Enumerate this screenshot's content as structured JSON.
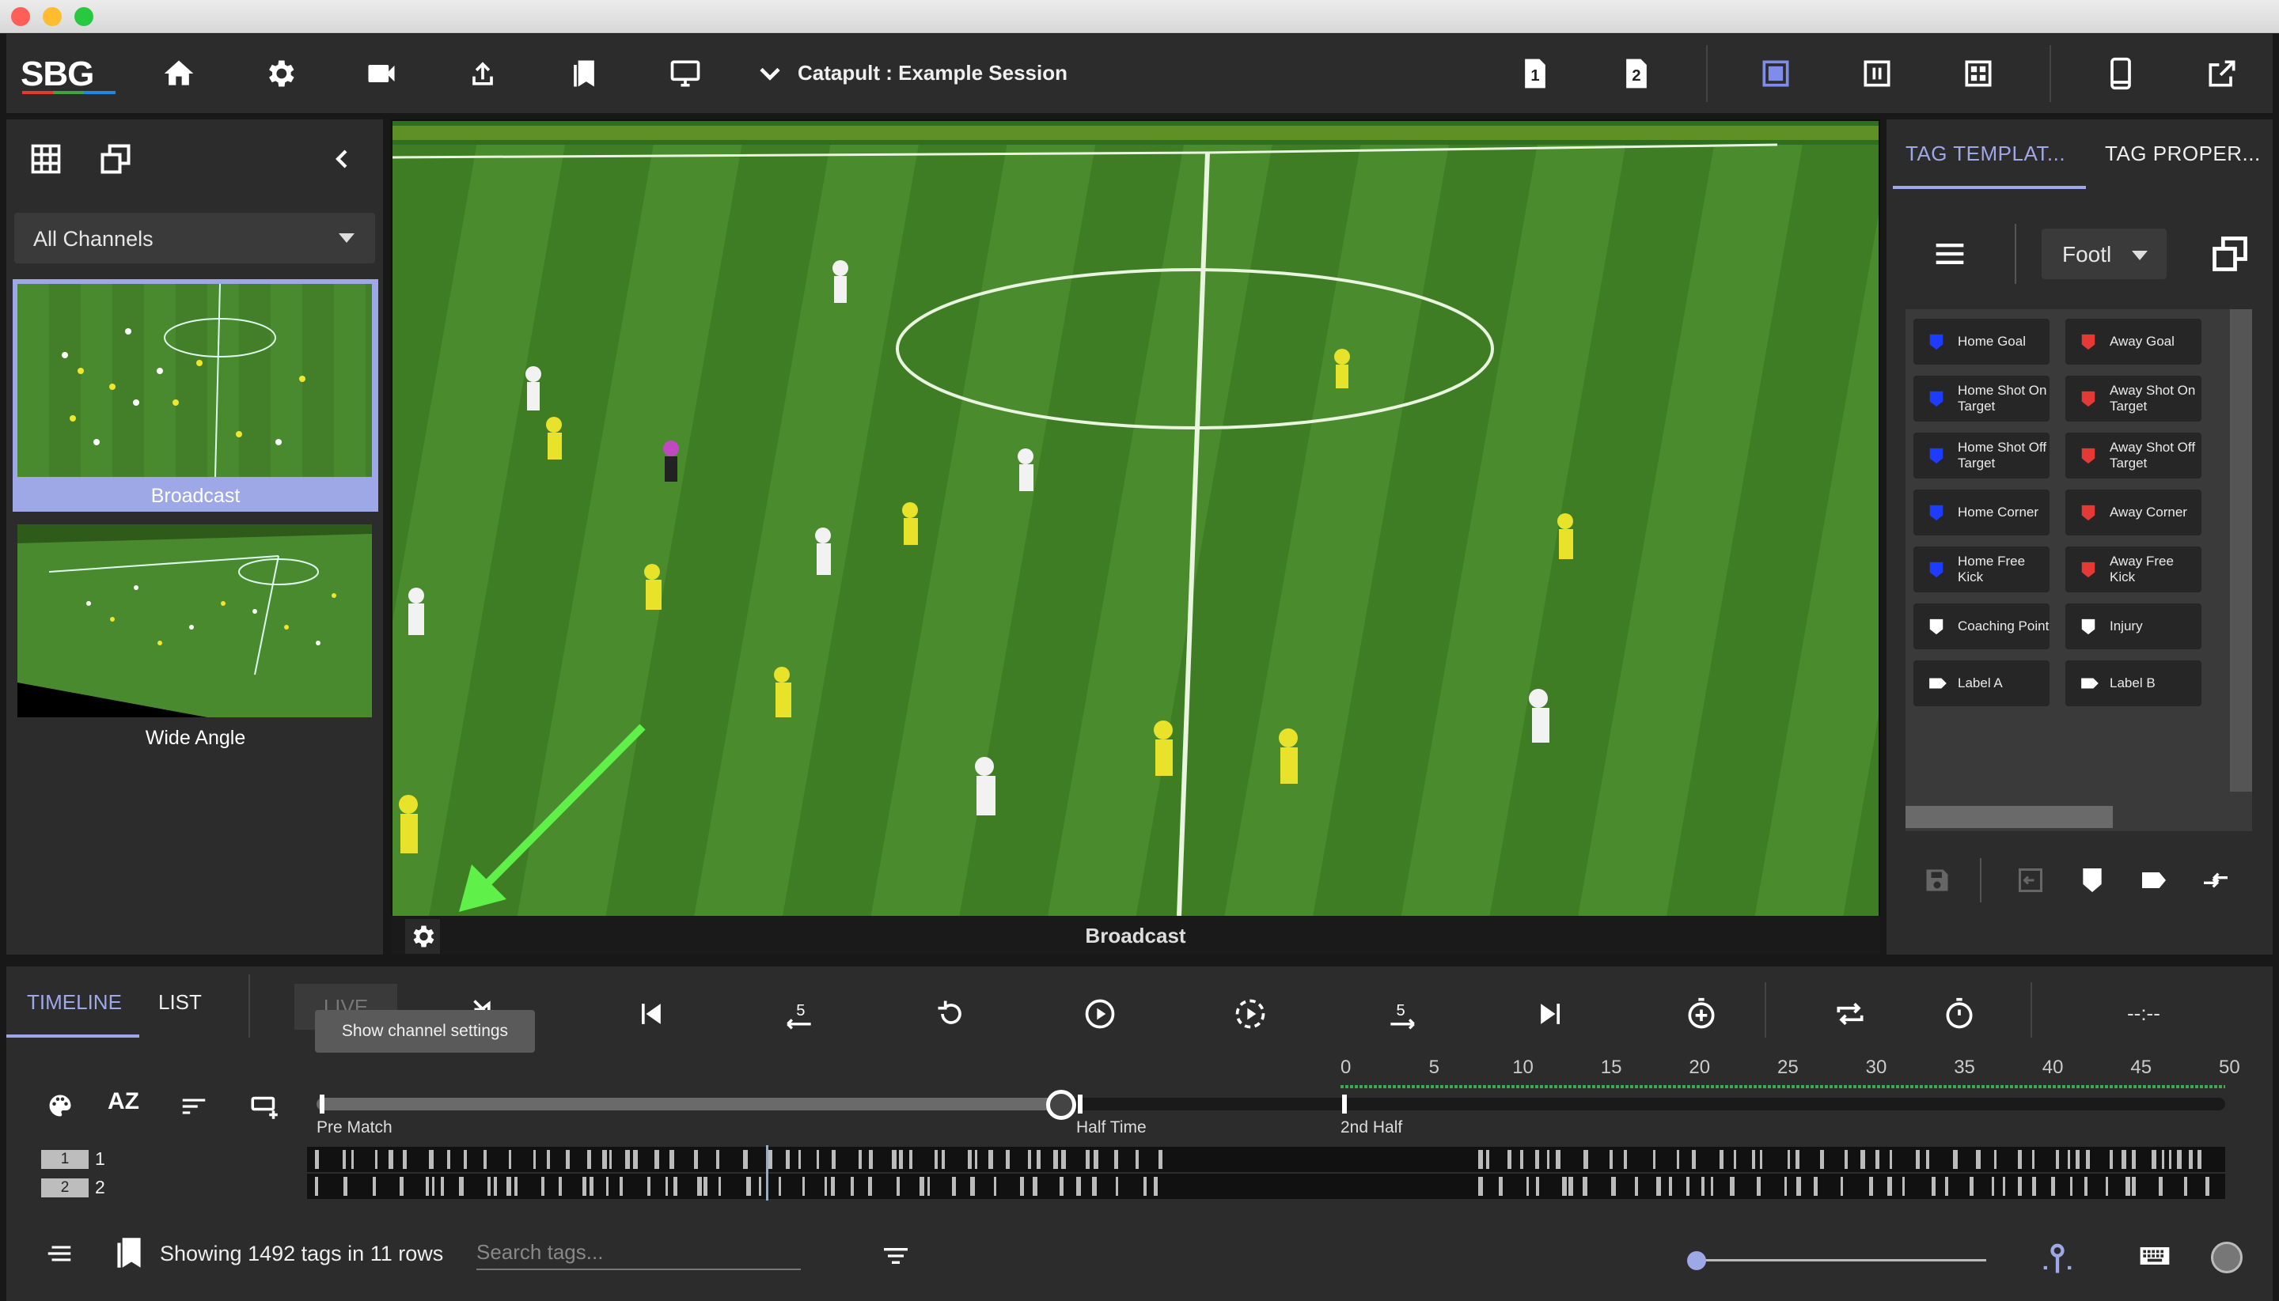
{
  "window": {
    "traffic_lights": [
      "#ff5f57",
      "#febc2e",
      "#28c840"
    ]
  },
  "toolbar": {
    "logo": "SBG",
    "session_title": "Catapult : Example Session",
    "icons": [
      "home-icon",
      "gear-icon",
      "camera-icon",
      "upload-icon",
      "bookmarks-icon",
      "monitor-icon",
      "chevron-down-icon",
      "page-1-icon",
      "page-2-icon",
      "layout-single-icon",
      "layout-split-icon",
      "layout-grid-icon",
      "tablet-icon",
      "open-external-icon"
    ],
    "page1_label": "1",
    "page2_label": "2",
    "accent": "#7e8ee8"
  },
  "left_panel": {
    "channel_select": "All Channels",
    "channels": [
      {
        "label": "Broadcast",
        "selected": true
      },
      {
        "label": "Wide Angle",
        "selected": false
      }
    ],
    "selected_color": "#9fa8e6"
  },
  "video": {
    "channel_name": "Broadcast"
  },
  "right_panel": {
    "tabs": [
      {
        "label": "TAG TEMPLAT...",
        "active": true
      },
      {
        "label": "TAG PROPER...",
        "active": false
      }
    ],
    "template_select": "Footl",
    "tags": [
      {
        "label": "Home Goal",
        "color": "#1e3cff"
      },
      {
        "label": "Away Goal",
        "color": "#e53935"
      },
      {
        "label": "Home Shot On Target",
        "color": "#1e3cff"
      },
      {
        "label": "Away Shot On Target",
        "color": "#e53935"
      },
      {
        "label": "Home Shot Off Target",
        "color": "#1e3cff"
      },
      {
        "label": "Away Shot Off Target",
        "color": "#e53935"
      },
      {
        "label": "Home Corner",
        "color": "#1e3cff"
      },
      {
        "label": "Away Corner",
        "color": "#e53935"
      },
      {
        "label": "Home Free Kick",
        "color": "#1e3cff"
      },
      {
        "label": "Away Free Kick",
        "color": "#e53935"
      },
      {
        "label": "Coaching Point",
        "color": "#ffffff"
      },
      {
        "label": "Injury",
        "color": "#ffffff"
      },
      {
        "label": "Label A",
        "color": "#ffffff"
      },
      {
        "label": "Label B",
        "color": "#ffffff"
      }
    ]
  },
  "bottom": {
    "tabs": [
      {
        "label": "TIMELINE",
        "active": true
      },
      {
        "label": "LIST",
        "active": false
      }
    ],
    "live_label": "LIVE",
    "skip_back_label": "5",
    "skip_fwd_label": "5",
    "time_display": "--:--",
    "tooltip": "Show channel settings",
    "ruler_ticks": [
      "0",
      "5",
      "10",
      "15",
      "20",
      "25",
      "30",
      "35",
      "40",
      "45",
      "50"
    ],
    "periods": [
      "Pre Match",
      "Half Time",
      "2nd Half"
    ],
    "rows": [
      {
        "badge": "1",
        "label": "1"
      },
      {
        "badge": "2",
        "label": "2"
      }
    ],
    "status": "Showing 1492 tags in 11 rows",
    "search_placeholder": "Search tags...",
    "progress": 0.39
  }
}
